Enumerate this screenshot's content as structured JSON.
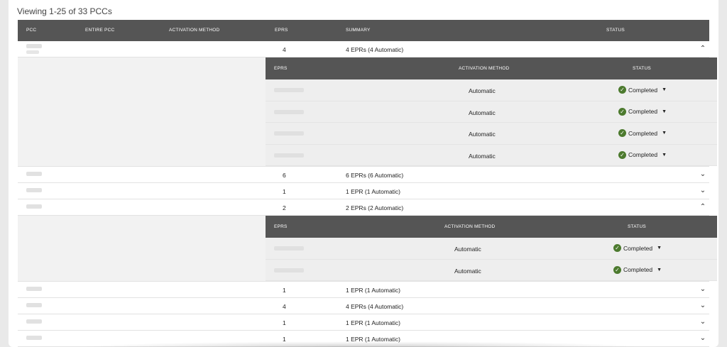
{
  "viewing": "Viewing 1-25 of 33 PCCs",
  "columns": {
    "pcc": "PCC",
    "entire_pcc": "ENTIRE PCC",
    "activation_method": "ACTIVATION METHOD",
    "eprs": "EPRs",
    "summary": "SUMMARY",
    "status": "STATUS"
  },
  "sub_columns": {
    "eprs": "EPRs",
    "activation_method": "ACTIVATION METHOD",
    "status": "STATUS"
  },
  "rows": [
    {
      "eprs": "4",
      "summary": "4 EPRs (4 Automatic)",
      "expanded": true,
      "sub": [
        {
          "method": "Automatic",
          "status": "Completed"
        },
        {
          "method": "Automatic",
          "status": "Completed"
        },
        {
          "method": "Automatic",
          "status": "Completed"
        },
        {
          "method": "Automatic",
          "status": "Completed"
        }
      ]
    },
    {
      "eprs": "6",
      "summary": "6 EPRs (6 Automatic)",
      "expanded": false
    },
    {
      "eprs": "1",
      "summary": "1 EPR (1 Automatic)",
      "expanded": false
    },
    {
      "eprs": "2",
      "summary": "2 EPRs (2 Automatic)",
      "expanded": true,
      "sub": [
        {
          "method": "Automatic",
          "status": "Completed"
        },
        {
          "method": "Automatic",
          "status": "Completed"
        }
      ]
    },
    {
      "eprs": "1",
      "summary": "1 EPR (1 Automatic)",
      "expanded": false
    },
    {
      "eprs": "4",
      "summary": "4 EPRs (4 Automatic)",
      "expanded": false
    },
    {
      "eprs": "1",
      "summary": "1 EPR (1 Automatic)",
      "expanded": false
    },
    {
      "eprs": "1",
      "summary": "1 EPR (1 Automatic)",
      "expanded": false
    }
  ],
  "icons": {
    "expanded": "chevron-up-icon",
    "collapsed": "chevron-down-icon",
    "status": "check-circle-icon",
    "dropdown": "caret-down-icon"
  },
  "colors": {
    "header_bg": "#555555",
    "status_ok": "#4c7a2e"
  }
}
